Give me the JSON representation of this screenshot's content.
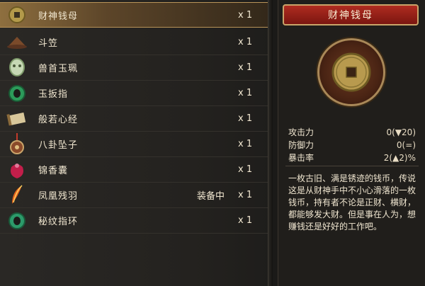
{
  "items": [
    {
      "name": "财神钱母",
      "status": "",
      "qty": "x 1",
      "icon": "coin-icon",
      "selected": true
    },
    {
      "name": "斗笠",
      "status": "",
      "qty": "x 1",
      "icon": "straw-hat-icon"
    },
    {
      "name": "兽首玉珮",
      "status": "",
      "qty": "x 1",
      "icon": "beast-jade-pendant-icon"
    },
    {
      "name": "玉扳指",
      "status": "",
      "qty": "x 1",
      "icon": "jade-ring-icon"
    },
    {
      "name": "般若心经",
      "status": "",
      "qty": "x 1",
      "icon": "scroll-icon"
    },
    {
      "name": "八卦坠子",
      "status": "",
      "qty": "x 1",
      "icon": "bagua-pendant-icon"
    },
    {
      "name": "锦香囊",
      "status": "",
      "qty": "x 1",
      "icon": "sachet-icon"
    },
    {
      "name": "凤凰残羽",
      "status": "装备中",
      "qty": "x 1",
      "icon": "phoenix-feather-icon"
    },
    {
      "name": "秘纹指环",
      "status": "",
      "qty": "x 1",
      "icon": "jade-ring-icon"
    }
  ],
  "detail": {
    "title": "财神钱母",
    "image_icon": "copper-coin-icon",
    "stats": [
      {
        "label": "攻击力",
        "value_prefix": "0(",
        "value_delta": "▼20",
        "value_suffix": ")",
        "tone": "red"
      },
      {
        "label": "防御力",
        "value_prefix": "0(",
        "value_delta": "=",
        "value_suffix": ")",
        "tone": "neutral"
      },
      {
        "label": "暴击率",
        "value_prefix": "2(",
        "value_delta": "▲2",
        "value_suffix": ")%",
        "tone": "green"
      }
    ],
    "description": "一枚古旧、满是锈迹的钱币，传说这是从财神手中不小心滑落的一枚钱币，持有者不论是正财、横财，都能够发大财。但是事在人为，想赚钱还是好好的工作吧。"
  },
  "colors": {
    "accent": "#b02c20",
    "up": "#3ad34a",
    "down": "#e83a2f",
    "gold": "#c9a46a"
  }
}
